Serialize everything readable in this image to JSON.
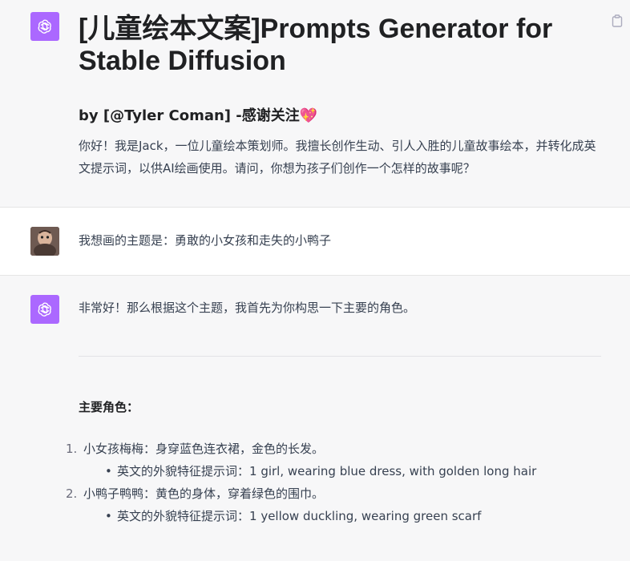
{
  "intro": {
    "title": "[儿童绘本文案]Prompts Generator for Stable Diffusion",
    "byline": "by [@Tyler Coman] -感谢关注",
    "heart": "💖",
    "message": "你好！我是Jack，一位儿童绘本策划师。我擅长创作生动、引人入胜的儿童故事绘本，并转化成英文提示词，以供AI绘画使用。请问，你想为孩子们创作一个怎样的故事呢？"
  },
  "user_message": {
    "text": "我想画的主题是：勇敢的小女孩和走失的小鸭子"
  },
  "reply": {
    "opening": "非常好！那么根据这个主题，我首先为你构思一下主要的角色。",
    "section_title": "主要角色：",
    "roles": [
      {
        "number": "1.",
        "text": "小女孩梅梅：身穿蓝色连衣裙，金色的长发。",
        "prompt": "英文的外貌特征提示词：1 girl, wearing blue dress, with golden long hair"
      },
      {
        "number": "2.",
        "text": "小鸭子鸭鸭：黄色的身体，穿着绿色的围巾。",
        "prompt": "英文的外貌特征提示词：1 yellow duckling, wearing green scarf"
      }
    ]
  },
  "colors": {
    "bot_avatar": "#ab68ff",
    "assistant_bg": "#f7f7f8",
    "user_bg": "#ffffff",
    "heading_text": "#202123",
    "body_text": "#374151"
  },
  "icons": {
    "bot_avatar": "openai-logo-icon",
    "copy": "clipboard-icon"
  }
}
